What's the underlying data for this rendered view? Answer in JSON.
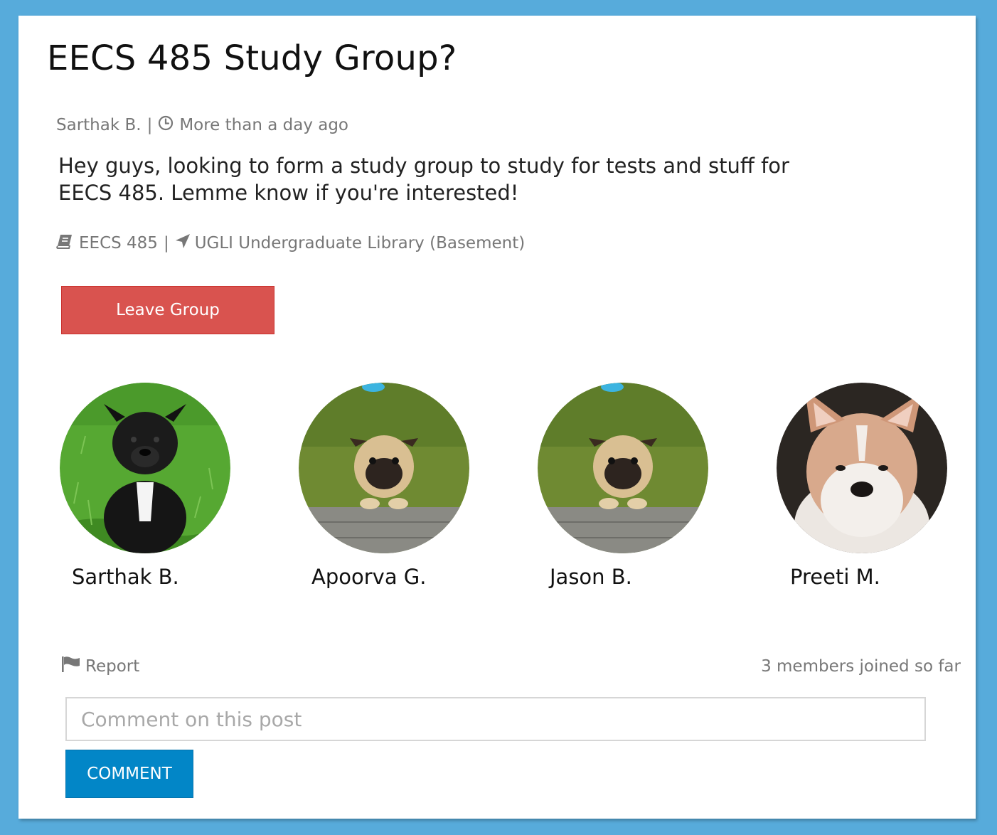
{
  "post": {
    "title": "EECS 485 Study Group?",
    "author": "Sarthak B.",
    "separator": "|",
    "time": "More than a day ago",
    "body": "Hey guys, looking to form a study group to study for tests and stuff for EECS 485. Lemme know if you're interested!",
    "course": "EECS 485",
    "location": "UGLI Undergraduate Library (Basement)"
  },
  "actions": {
    "leave_label": "Leave Group",
    "report_label": "Report",
    "comment_button_label": "COMMENT"
  },
  "members": [
    {
      "name": "Sarthak B.",
      "avatar": "black-puppy-avatar"
    },
    {
      "name": "Apoorva G.",
      "avatar": "pug-avatar"
    },
    {
      "name": "Jason B.",
      "avatar": "pug-avatar"
    },
    {
      "name": "Preeti M.",
      "avatar": "akita-puppy-avatar"
    }
  ],
  "members_joined_text": "3 members joined so far",
  "comment": {
    "placeholder": "Comment on this post",
    "value": ""
  },
  "colors": {
    "page_background": "#57abdb",
    "leave_button": "#d9534f",
    "comment_button": "#0286c7",
    "meta_text": "#777777"
  },
  "icons": {
    "time": "clock-icon",
    "course": "book-icon",
    "location": "location-arrow-icon",
    "report": "flag-icon"
  }
}
